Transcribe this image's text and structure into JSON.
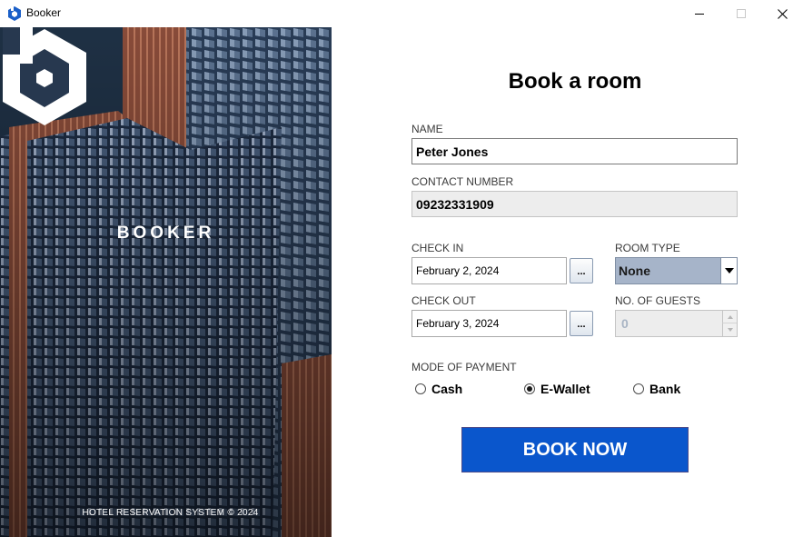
{
  "window": {
    "title": "Booker",
    "app_icon": "booker-hexagon-icon",
    "controls": [
      "minimize-icon",
      "maximize-icon",
      "close-icon"
    ]
  },
  "hero": {
    "brand_name": "BOOKER",
    "footer": "HOTEL RESERVATION SYSTEM © 2024"
  },
  "form": {
    "heading": "Book a room",
    "name": {
      "label": "NAME",
      "value": "Peter Jones"
    },
    "contact": {
      "label": "CONTACT NUMBER",
      "value": "09232331909"
    },
    "check_in": {
      "label": "CHECK IN",
      "value": "February 2, 2024",
      "button": "..."
    },
    "check_out": {
      "label": "CHECK OUT",
      "value": "February 3, 2024",
      "button": "..."
    },
    "room_type": {
      "label": "ROOM TYPE",
      "value": "None"
    },
    "guests": {
      "label": "NO. OF GUESTS",
      "value": "0"
    },
    "payment": {
      "label": "MODE OF PAYMENT",
      "options": [
        {
          "label": "Cash",
          "selected": false
        },
        {
          "label": "E-Wallet",
          "selected": true
        },
        {
          "label": "Bank",
          "selected": false
        }
      ]
    },
    "submit_label": "BOOK NOW"
  },
  "colors": {
    "accent": "#0a56cc",
    "combo_bg": "#a6b4c9",
    "disabled_bg": "#ededed"
  }
}
